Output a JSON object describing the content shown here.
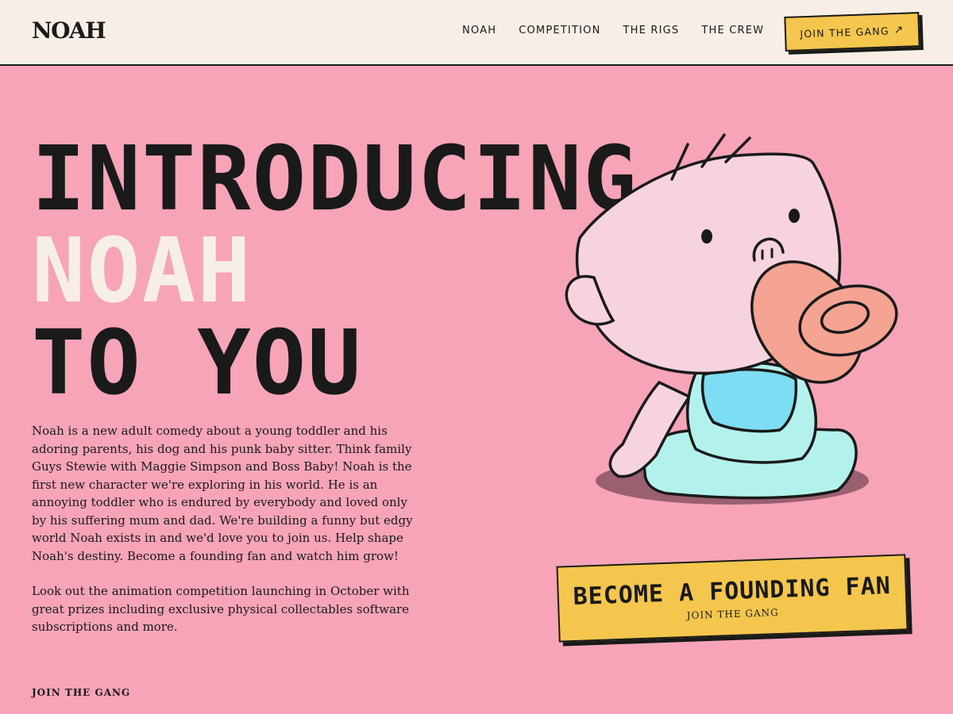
{
  "navbar": {
    "logo": "NOAH",
    "links": [
      "NOAH",
      "COMPETITION",
      "THE RIGS",
      "THE CREW"
    ],
    "cta_label": "JOIN THE GANG",
    "cta_icon": "arrow-up-right-icon"
  },
  "hero": {
    "title_line1": "INTRODUCING",
    "title_line2": "NOAH",
    "title_line3": "TO YOU",
    "paragraph1": "Noah is a new adult comedy about a young toddler and his adoring parents, his dog and his punk baby sitter. Think family Guys Stewie with Maggie Simpson and Boss Baby! Noah is the first new character we're exploring in his world. He is an annoying toddler who is endured by everybody and loved only by his suffering mum and dad. We're building a funny but edgy world Noah exists in and we'd love you to join us. Help shape Noah's destiny. Become a founding fan and watch him grow!",
    "paragraph2": "Look out the animation competition launching in October with great prizes including exclusive physical collectables software subscriptions and more.",
    "footer_link": "JOIN THE GANG"
  },
  "cta": {
    "title": "BECOME A FOUNDING FAN",
    "subtitle": "JOIN THE GANG"
  },
  "colors": {
    "background": "#f7a4b8",
    "navbar": "#f7efe6",
    "accent_yellow": "#f5c64d",
    "accent_cream": "#f7efe6",
    "ink": "#1a1a1a"
  }
}
